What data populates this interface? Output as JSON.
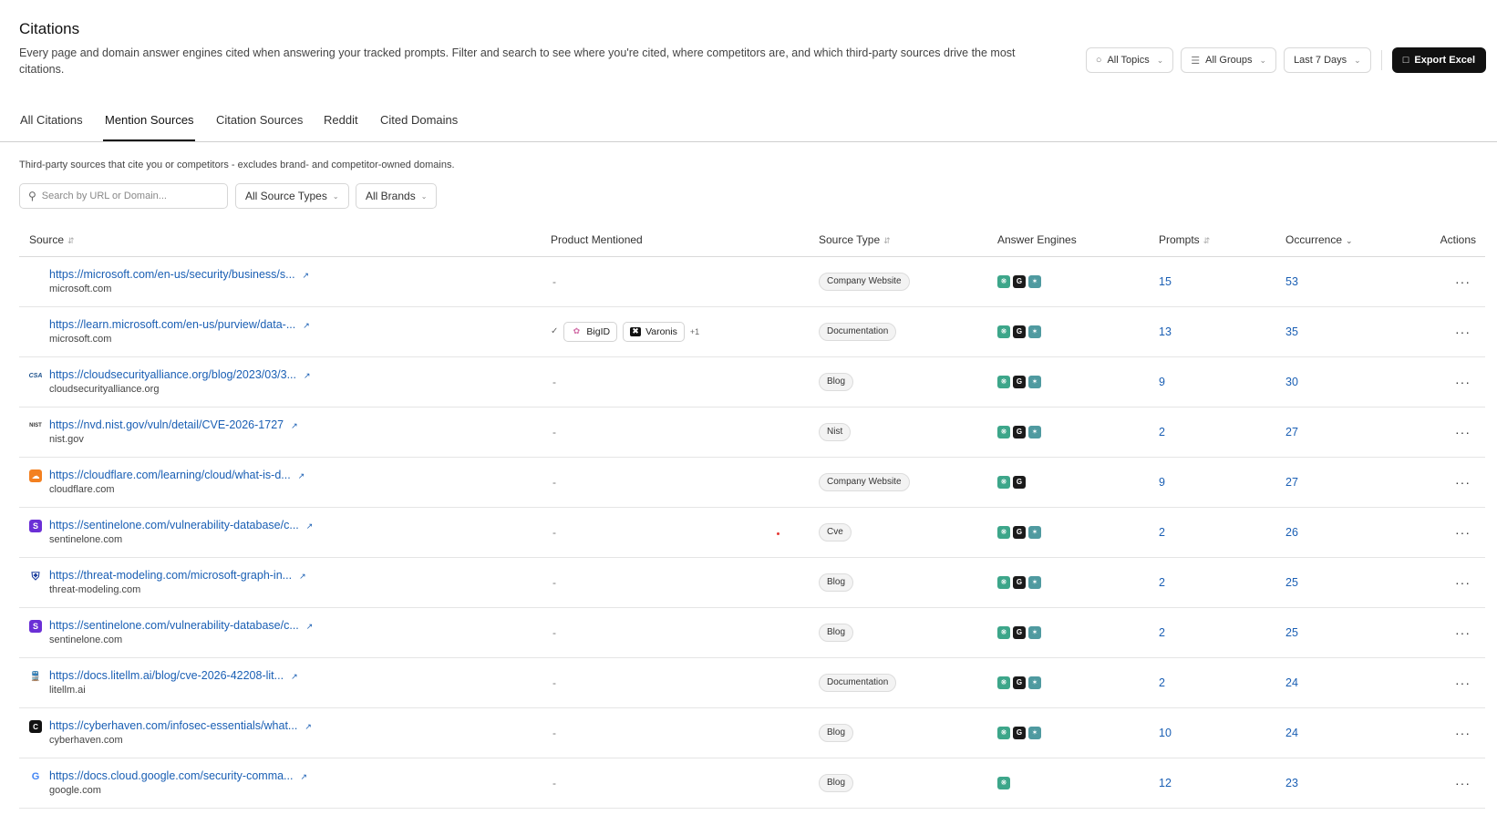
{
  "header": {
    "title": "Citations",
    "description": "Every page and domain answer engines cited when answering your tracked prompts. Filter and search to see where you're cited, where competitors are, and which third-party sources drive the most citations."
  },
  "controls": {
    "topics": "All Topics",
    "groups": "All Groups",
    "range": "Last 7 Days",
    "export": "Export Excel"
  },
  "tabs": [
    "All Citations",
    "Mention Sources",
    "Citation Sources",
    "Reddit",
    "Cited Domains"
  ],
  "active_tab": "Mention Sources",
  "subdescription": "Third-party sources that cite you or competitors - excludes brand- and competitor-owned domains.",
  "search": {
    "placeholder": "Search by URL or Domain..."
  },
  "filters": {
    "source_types": "All Source Types",
    "brands": "All Brands"
  },
  "columns": {
    "source": "Source",
    "product": "Product Mentioned",
    "type": "Source Type",
    "engines": "Answer Engines",
    "prompts": "Prompts",
    "occurrence": "Occurrence",
    "actions": "Actions"
  },
  "rows": [
    {
      "url": "https://microsoft.com/en-us/security/business/s...",
      "domain": "microsoft.com",
      "favicon": "microsoft",
      "product": "-",
      "type": "Company Website",
      "engines": [
        "chatgpt",
        "google",
        "perplexity"
      ],
      "prompts": "15",
      "occurrence": "53"
    },
    {
      "url": "https://learn.microsoft.com/en-us/purview/data-...",
      "domain": "microsoft.com",
      "favicon": "microsoft",
      "product": "",
      "chips": [
        "BigID",
        "Varonis"
      ],
      "chips_more": "+1",
      "type": "Documentation",
      "engines": [
        "chatgpt",
        "google",
        "perplexity"
      ],
      "prompts": "13",
      "occurrence": "35"
    },
    {
      "url": "https://cloudsecurityalliance.org/blog/2023/03/3...",
      "domain": "cloudsecurityalliance.org",
      "favicon": "csa",
      "favicon_text": "CSA",
      "product": "-",
      "type": "Blog",
      "engines": [
        "chatgpt",
        "google",
        "perplexity"
      ],
      "prompts": "9",
      "occurrence": "30"
    },
    {
      "url": "https://nvd.nist.gov/vuln/detail/CVE-2026-1727",
      "domain": "nist.gov",
      "favicon": "nist",
      "favicon_text": "NIST",
      "product": "-",
      "type": "Nist",
      "engines": [
        "chatgpt",
        "google",
        "perplexity"
      ],
      "prompts": "2",
      "occurrence": "27"
    },
    {
      "url": "https://cloudflare.com/learning/cloud/what-is-d...",
      "domain": "cloudflare.com",
      "favicon": "cloudflare",
      "product": "-",
      "type": "Company Website",
      "engines": [
        "chatgpt",
        "google"
      ],
      "prompts": "9",
      "occurrence": "27"
    },
    {
      "url": "https://sentinelone.com/vulnerability-database/c...",
      "domain": "sentinelone.com",
      "favicon": "sentinelone",
      "product": "-",
      "type": "Cve",
      "engines": [
        "chatgpt",
        "google",
        "perplexity"
      ],
      "prompts": "2",
      "occurrence": "26"
    },
    {
      "url": "https://threat-modeling.com/microsoft-graph-in...",
      "domain": "threat-modeling.com",
      "favicon": "shield",
      "product": "-",
      "type": "Blog",
      "engines": [
        "chatgpt",
        "google",
        "perplexity"
      ],
      "prompts": "2",
      "occurrence": "25"
    },
    {
      "url": "https://sentinelone.com/vulnerability-database/c...",
      "domain": "sentinelone.com",
      "favicon": "sentinelone",
      "product": "-",
      "type": "Blog",
      "engines": [
        "chatgpt",
        "google",
        "perplexity"
      ],
      "prompts": "2",
      "occurrence": "25"
    },
    {
      "url": "https://docs.litellm.ai/blog/cve-2026-42208-lit...",
      "domain": "litellm.ai",
      "favicon": "litellm",
      "product": "-",
      "type": "Documentation",
      "engines": [
        "chatgpt",
        "google",
        "perplexity"
      ],
      "prompts": "2",
      "occurrence": "24"
    },
    {
      "url": "https://cyberhaven.com/infosec-essentials/what...",
      "domain": "cyberhaven.com",
      "favicon": "cyberhaven",
      "product": "-",
      "type": "Blog",
      "engines": [
        "chatgpt",
        "google",
        "perplexity"
      ],
      "prompts": "10",
      "occurrence": "24"
    },
    {
      "url": "https://docs.cloud.google.com/security-comma...",
      "domain": "google.com",
      "favicon": "google",
      "favicon_text": "G",
      "product": "-",
      "type": "Blog",
      "engines": [
        "chatgpt"
      ],
      "prompts": "12",
      "occurrence": "23"
    }
  ],
  "colors": {
    "link": "#1a5fb4",
    "chatgpt": "#3da68a",
    "perplexity": "#4f9aa0",
    "export_bg": "#111111"
  }
}
